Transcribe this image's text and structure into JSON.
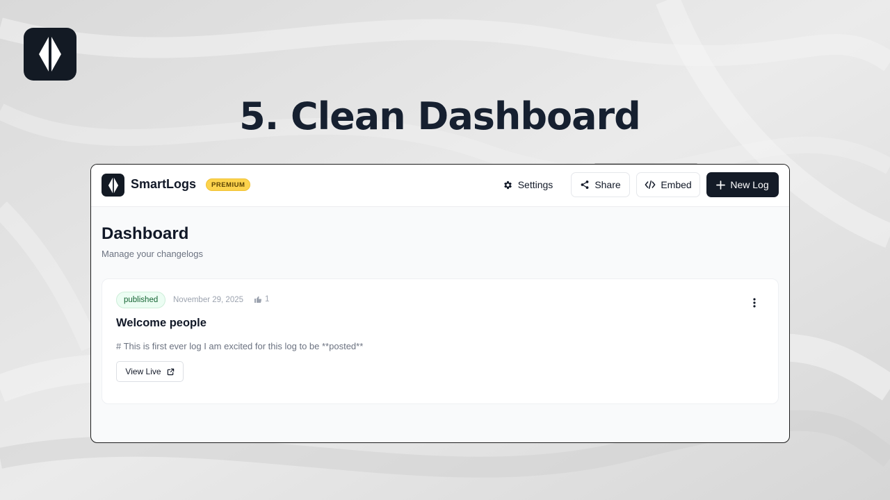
{
  "slide": {
    "title": "5. Clean Dashboard",
    "logo_icon": "diamond-logo-icon",
    "background": "#e4e4e4",
    "title_color": "#162030"
  },
  "header": {
    "app_name": "SmartLogs",
    "badge": "PREMIUM",
    "settings_label": "Settings",
    "share_label": "Share",
    "embed_label": "Embed",
    "new_log_label": "New Log",
    "icons": [
      "gear-icon",
      "share-icon",
      "code-icon",
      "plus-icon"
    ]
  },
  "page": {
    "title": "Dashboard",
    "subtitle": "Manage your changelogs"
  },
  "logs": [
    {
      "status": "published",
      "date": "November 29, 2025",
      "likes": "1",
      "title": "Welcome people",
      "excerpt": "# This is first ever log I am excited for this log to be **posted**",
      "action_label": "View Live"
    }
  ],
  "colors": {
    "brand_dark": "#131a24",
    "premium_yellow": "#fcd34d",
    "published_green": "#166534",
    "published_bg": "#ecfdf3",
    "muted_text": "#6b7280"
  }
}
